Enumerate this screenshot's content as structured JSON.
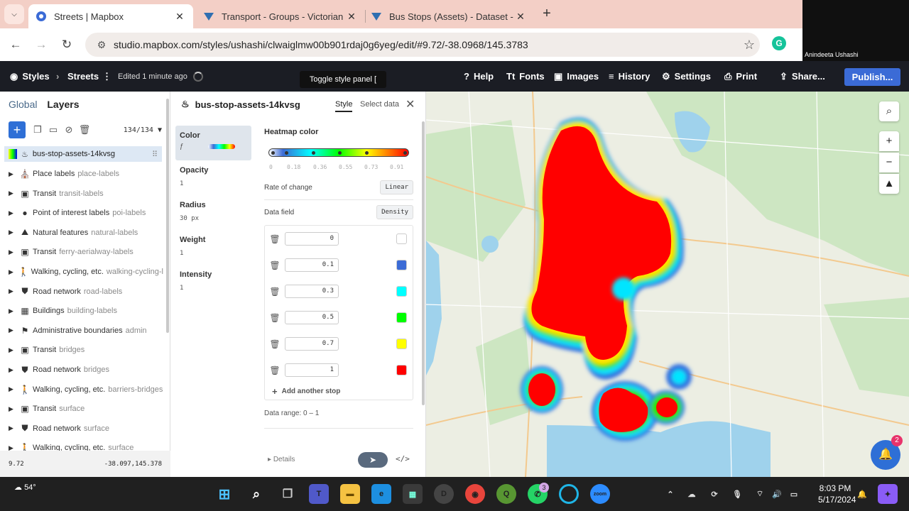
{
  "browser": {
    "tabs": [
      {
        "title": "Streets | Mapbox"
      },
      {
        "title": "Transport - Groups - Victorian"
      },
      {
        "title": "Bus Stops (Assets) - Dataset - V"
      }
    ],
    "url": "studio.mapbox.com/styles/ushashi/clwaiglmw00b901rdaj0g6yeg/edit/#9.72/-38.0968/145.3783",
    "webcam_name": "Anindeeta Ushashi"
  },
  "header": {
    "styles": "Styles",
    "style_name": "Streets",
    "edited": "Edited 1 minute ago",
    "tooltip": "Toggle style panel  [",
    "help": "Help",
    "fonts": "Fonts",
    "images": "Images",
    "history": "History",
    "settings": "Settings",
    "print": "Print",
    "share": "Share...",
    "publish": "Publish..."
  },
  "left_panel": {
    "tab_global": "Global",
    "tab_layers": "Layers",
    "count": "134/134",
    "selected_layer": "bus-stop-assets-14kvsg",
    "layers": [
      {
        "name": "Place labels",
        "source": "place-labels",
        "icon": "place-icon"
      },
      {
        "name": "Transit",
        "source": "transit-labels",
        "icon": "transit-icon"
      },
      {
        "name": "Point of interest labels",
        "source": "poi-labels",
        "icon": "poi-icon"
      },
      {
        "name": "Natural features",
        "source": "natural-labels",
        "icon": "natural-icon"
      },
      {
        "name": "Transit",
        "source": "ferry-aerialway-labels",
        "icon": "transit-icon"
      },
      {
        "name": "Walking, cycling, etc.",
        "source": "walking-cycling-l",
        "icon": "walking-icon"
      },
      {
        "name": "Road network",
        "source": "road-labels",
        "icon": "road-icon"
      },
      {
        "name": "Buildings",
        "source": "building-labels",
        "icon": "building-icon"
      },
      {
        "name": "Administrative boundaries",
        "source": "admin",
        "icon": "admin-icon"
      },
      {
        "name": "Transit",
        "source": "bridges",
        "icon": "transit-icon"
      },
      {
        "name": "Road network",
        "source": "bridges",
        "icon": "road-icon"
      },
      {
        "name": "Walking, cycling, etc.",
        "source": "barriers-bridges",
        "icon": "walking-icon"
      },
      {
        "name": "Transit",
        "source": "surface",
        "icon": "transit-icon"
      },
      {
        "name": "Road network",
        "source": "surface",
        "icon": "road-icon"
      },
      {
        "name": "Walking, cycling, etc.",
        "source": "surface",
        "icon": "walking-icon"
      }
    ],
    "zoom": "9.72",
    "coords": "-38.097,145.378"
  },
  "editor": {
    "layer_title": "bus-stop-assets-14kvsg",
    "tab_style": "Style",
    "tab_select": "Select data",
    "properties": [
      {
        "label": "Color",
        "value": ""
      },
      {
        "label": "Opacity",
        "value": "1"
      },
      {
        "label": "Radius",
        "value": "30 px"
      },
      {
        "label": "Weight",
        "value": "1"
      },
      {
        "label": "Intensity",
        "value": "1"
      }
    ],
    "heatmap_label": "Heatmap color",
    "ticks": [
      "0",
      "0.18",
      "0.36",
      "0.55",
      "0.73",
      "0.91"
    ],
    "rate_label": "Rate of change",
    "rate_value": "Linear",
    "field_label": "Data field",
    "field_value": "Density",
    "stops": [
      {
        "value": "0",
        "color": "#ffffff"
      },
      {
        "value": "0.1",
        "color": "#3b6bd6"
      },
      {
        "value": "0.3",
        "color": "#00ffff"
      },
      {
        "value": "0.5",
        "color": "#00ff00"
      },
      {
        "value": "0.7",
        "color": "#ffff00"
      },
      {
        "value": "1",
        "color": "#ff0000"
      }
    ],
    "add_stop": "Add another stop",
    "data_range": "Data range: 0 – 1",
    "details": "Details",
    "code": "</>"
  },
  "notifications": {
    "badge": "2"
  },
  "taskbar": {
    "temperature": "54°",
    "time": "8:03 PM",
    "date": "5/17/2024",
    "whatsapp_badge": "3"
  }
}
